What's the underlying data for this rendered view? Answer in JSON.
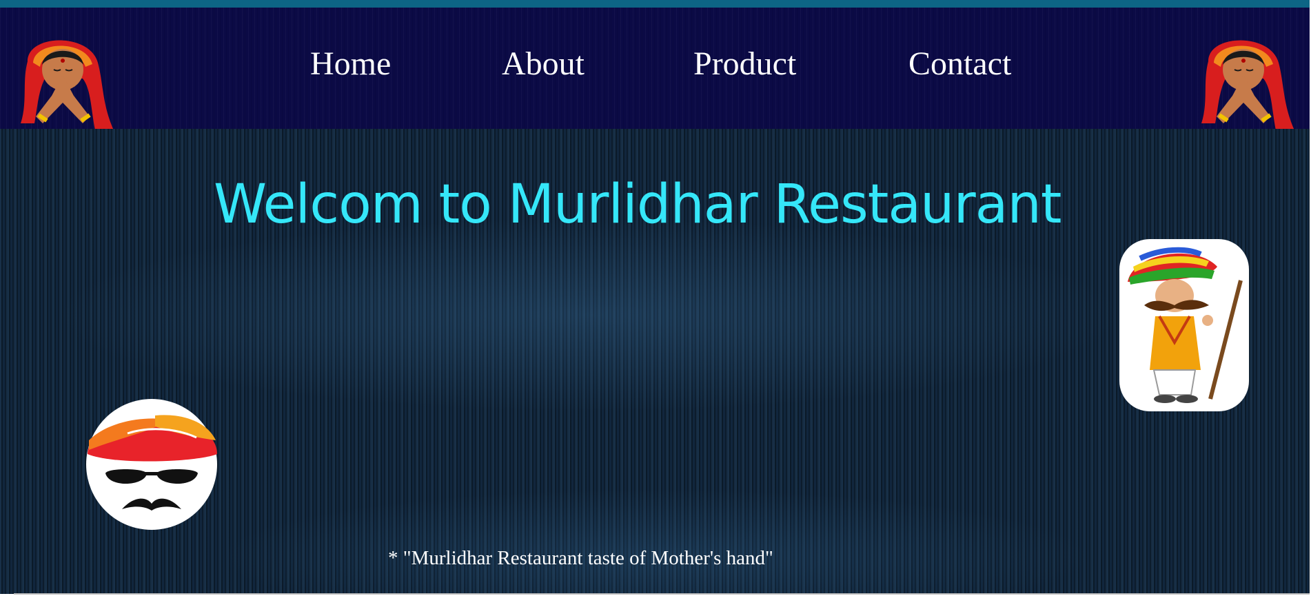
{
  "nav": {
    "links": [
      "Home",
      "About",
      "Product",
      "Contact"
    ],
    "left_logo_icon": "namaste-woman-icon",
    "right_logo_icon": "namaste-woman-icon"
  },
  "hero": {
    "title": "Welcom to Murlidhar Restaurant",
    "title_color": "#35e7f9",
    "tagline": "* \"Murlidhar Restaurant taste of Mother's hand\"",
    "left_image_icon": "turban-sunglasses-mustache-icon",
    "right_image_icon": "rajasthani-man-with-stick-icon"
  },
  "colors": {
    "top_strip": "#0d6585",
    "navbar_bg": "#0b0a45",
    "hero_bg": "#0f2236"
  }
}
